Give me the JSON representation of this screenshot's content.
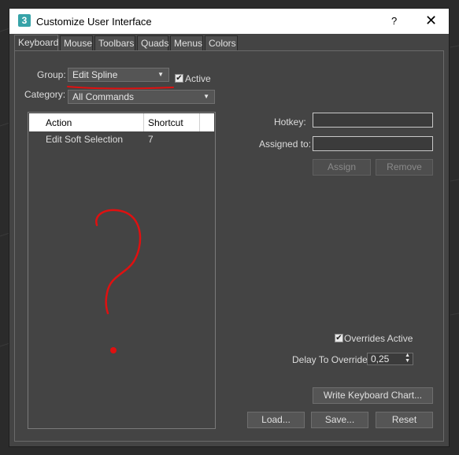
{
  "window": {
    "app_icon": "3",
    "title": "Customize User Interface",
    "help": "?",
    "close": "✕"
  },
  "tabs": [
    {
      "label": "Keyboard",
      "active": true
    },
    {
      "label": "Mouse"
    },
    {
      "label": "Toolbars"
    },
    {
      "label": "Quads"
    },
    {
      "label": "Menus"
    },
    {
      "label": "Colors"
    }
  ],
  "group": {
    "label": "Group:",
    "value": "Edit Spline"
  },
  "active_checkbox": {
    "label": "Active",
    "checked": true,
    "mark": "✔"
  },
  "category": {
    "label": "Category:",
    "value": "All Commands"
  },
  "dropdown_arrow": "▼",
  "list": {
    "columns": [
      "Action",
      "Shortcut"
    ],
    "rows": [
      {
        "action": "Edit Soft Selection",
        "shortcut": "7"
      }
    ]
  },
  "hotkey": {
    "label": "Hotkey:",
    "value": ""
  },
  "assigned_to": {
    "label": "Assigned to:",
    "value": ""
  },
  "buttons": {
    "assign": "Assign",
    "remove": "Remove",
    "write_chart": "Write Keyboard Chart...",
    "load": "Load...",
    "save": "Save...",
    "reset": "Reset"
  },
  "overrides": {
    "label": "Overrides Active",
    "checked": true,
    "mark": "✔"
  },
  "delay": {
    "label": "Delay To Override:",
    "value": "0,25",
    "spin": "▲\n▼"
  },
  "annotation": {
    "color": "#e01010"
  }
}
